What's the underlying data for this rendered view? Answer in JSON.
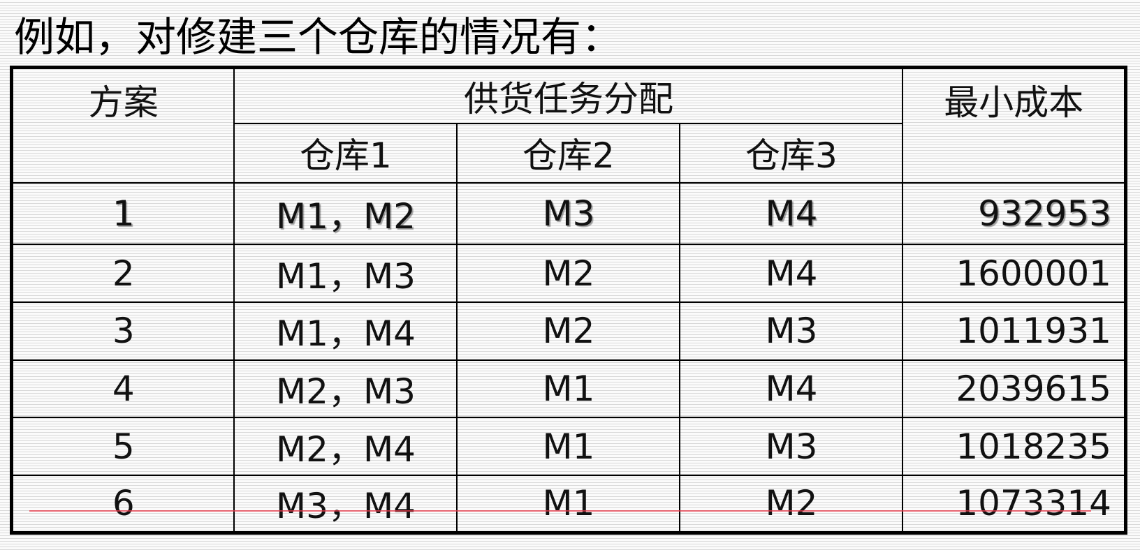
{
  "title": "例如，对修建三个仓库的情况有：",
  "table": {
    "headers": {
      "plan": "方案",
      "supply_assignment": "供货任务分配",
      "min_cost": "最小成本",
      "warehouses": [
        "仓库1",
        "仓库2",
        "仓库3"
      ]
    },
    "rows": [
      {
        "plan": "1",
        "wh1": "M1，M2",
        "wh2": "M3",
        "wh3": "M4",
        "cost": "932953",
        "highlight": true
      },
      {
        "plan": "2",
        "wh1": "M1，M3",
        "wh2": "M2",
        "wh3": "M4",
        "cost": "1600001",
        "highlight": false
      },
      {
        "plan": "3",
        "wh1": "M1，M4",
        "wh2": "M2",
        "wh3": "M3",
        "cost": "1011931",
        "highlight": false
      },
      {
        "plan": "4",
        "wh1": "M2，M3",
        "wh2": "M1",
        "wh3": "M4",
        "cost": "2039615",
        "highlight": false
      },
      {
        "plan": "5",
        "wh1": "M2，M4",
        "wh2": "M1",
        "wh3": "M3",
        "cost": "1018235",
        "highlight": false
      },
      {
        "plan": "6",
        "wh1": "M3，M4",
        "wh2": "M1",
        "wh3": "M2",
        "cost": "1073314",
        "highlight": false
      }
    ]
  },
  "colors": {
    "highlight_text": "#e8121b",
    "stray_line": "#e8394a"
  }
}
